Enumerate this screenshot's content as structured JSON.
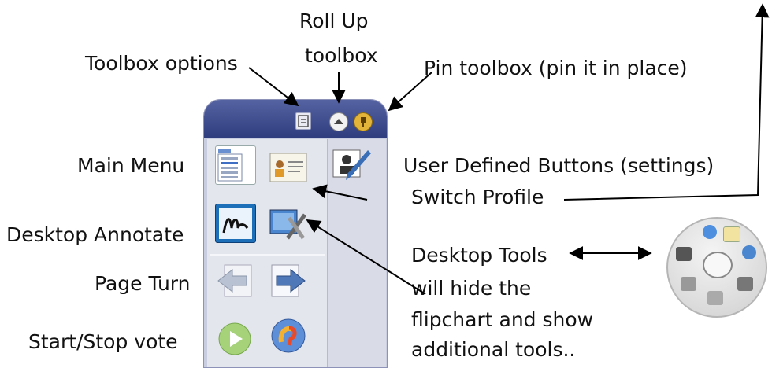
{
  "labels": {
    "roll_up_line1": "Roll Up",
    "roll_up_line2": "toolbox",
    "toolbox_options": "Toolbox options",
    "pin_toolbox": "Pin toolbox (pin it in place)",
    "main_menu": "Main Menu",
    "user_defined": "User Defined Buttons (settings)",
    "switch_profile": "Switch Profile",
    "desktop_annotate": "Desktop Annotate",
    "desktop_tools": "Desktop Tools",
    "desktop_tools_note": [
      "will hide the",
      "flipchart and show",
      "additional tools.."
    ],
    "page_turn": "Page Turn",
    "start_stop_vote": "Start/Stop vote"
  },
  "icons": {
    "toolbox_options": "options-icon",
    "roll_up": "roll-up-icon",
    "pin": "pin-icon",
    "main_menu": "main-menu-icon",
    "switch_profile": "profile-card-icon",
    "user_defined": "user-pen-icon",
    "annotate": "annotate-icon",
    "desktop_tools": "desktop-tools-icon",
    "page_back": "page-back-icon",
    "page_forward": "page-forward-icon",
    "start_vote": "play-icon",
    "stop_vote": "vote-icon"
  },
  "colors": {
    "toolbox_header": "#2f3d7e",
    "toolbox_body": "#e4e6ee",
    "annotate_tile": "#1d6fb8"
  }
}
